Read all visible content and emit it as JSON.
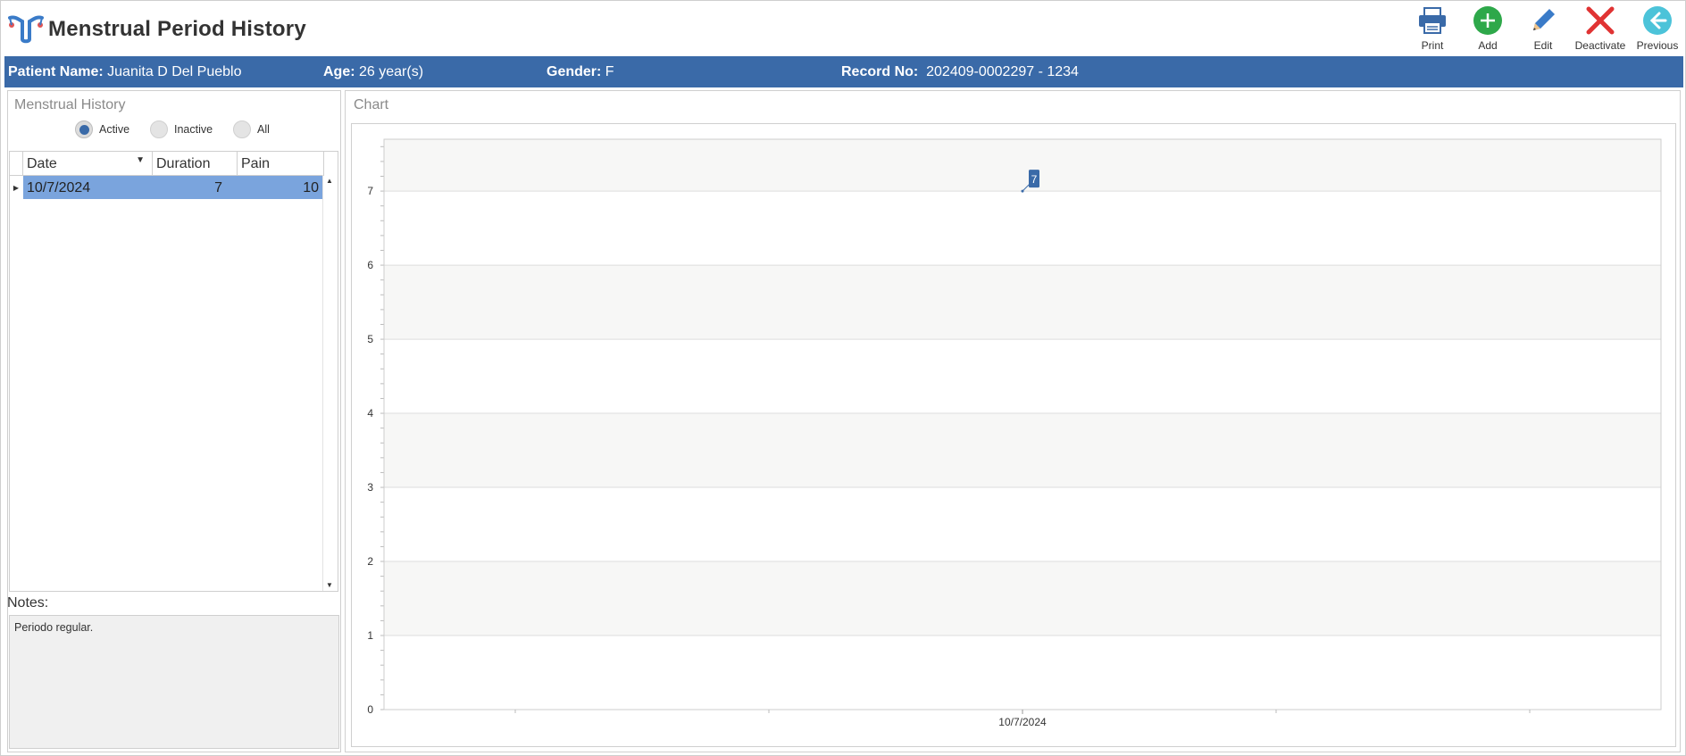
{
  "app": {
    "title": "Menstrual Period History",
    "logo_icon": "uterus-icon",
    "accent_color": "#3a6aa8"
  },
  "toolbar": [
    {
      "name": "print-button",
      "label": "Print",
      "icon": "printer-icon"
    },
    {
      "name": "add-button",
      "label": "Add",
      "icon": "plus-circle-icon"
    },
    {
      "name": "edit-button",
      "label": "Edit",
      "icon": "pencil-icon"
    },
    {
      "name": "deactivate-button",
      "label": "Deactivate",
      "icon": "x-icon"
    },
    {
      "name": "previous-button",
      "label": "Previous",
      "icon": "arrow-left-circle-icon"
    }
  ],
  "patient": {
    "name_label": "Patient Name:",
    "name": "Juanita D Del Pueblo",
    "age_label": "Age:",
    "age": "26 year(s)",
    "gender_label": "Gender:",
    "gender": "F",
    "record_label": "Record No:",
    "record": "202409-0002297 - 1234"
  },
  "history": {
    "title": "Menstrual History",
    "filters": [
      {
        "label": "Active",
        "selected": true
      },
      {
        "label": "Inactive",
        "selected": false
      },
      {
        "label": "All",
        "selected": false
      }
    ],
    "columns": [
      "Date",
      "Duration",
      "Pain"
    ],
    "rows": [
      {
        "date": "10/7/2024",
        "duration": "7",
        "pain": "10"
      }
    ]
  },
  "notes": {
    "label": "Notes:",
    "text": "Periodo regular."
  },
  "chart_panel": {
    "title": "Chart"
  },
  "chart_data": {
    "type": "line",
    "x": [
      "10/7/2024"
    ],
    "values": [
      7
    ],
    "data_labels": [
      "7"
    ],
    "ylim": [
      0,
      7.7
    ],
    "yticks": [
      0,
      1,
      2,
      3,
      4,
      5,
      6,
      7
    ],
    "grid": true,
    "series_color": "#3a6aa8"
  }
}
